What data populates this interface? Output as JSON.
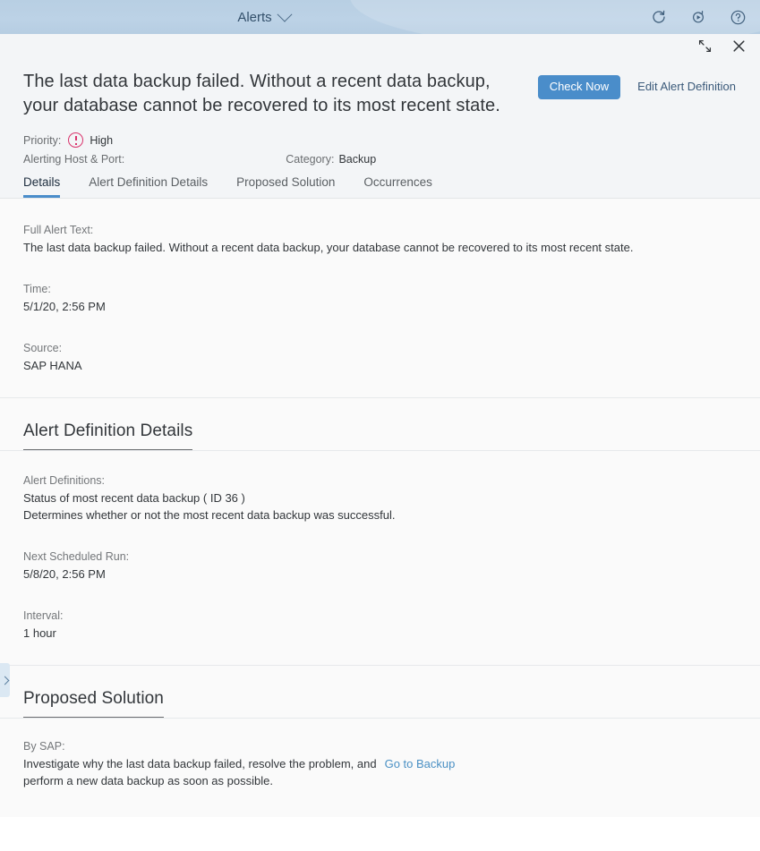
{
  "shell": {
    "title": "Alerts",
    "dropdown_icon": "chevron-down-icon",
    "actions": [
      {
        "name": "refresh-icon",
        "label": "Refresh"
      },
      {
        "name": "auto-refresh-icon",
        "label": "Auto Refresh"
      },
      {
        "name": "help-icon",
        "label": "Help"
      }
    ]
  },
  "dialog_toolbar": {
    "fullscreen_label": "Enter Full Screen",
    "close_label": "Close"
  },
  "alert": {
    "title": "The last data backup failed. Without a recent data backup, your database cannot be recovered to its most recent state.",
    "buttons": {
      "check_now": "Check Now",
      "edit_alert_definition": "Edit Alert Definition"
    },
    "priority_label": "Priority:",
    "priority_value": "High",
    "priority_icon": "alert-circle-icon",
    "host_label": "Alerting Host & Port:",
    "host_value": "",
    "category_label": "Category:",
    "category_value": "Backup"
  },
  "tabs": [
    {
      "label": "Details",
      "selected": true
    },
    {
      "label": "Alert Definition Details",
      "selected": false
    },
    {
      "label": "Proposed Solution",
      "selected": false
    },
    {
      "label": "Occurrences",
      "selected": false
    }
  ],
  "details": {
    "full_alert_text_label": "Full Alert Text:",
    "full_alert_text_value": "The last data backup failed. Without a recent data backup, your database cannot be recovered to its most recent state.",
    "time_label": "Time:",
    "time_value": "5/1/20, 2:56 PM",
    "source_label": "Source:",
    "source_value": "SAP HANA"
  },
  "alert_definition_details": {
    "heading": "Alert Definition Details",
    "definitions_label": "Alert Definitions:",
    "definitions_value_line1": "Status of most recent data backup ( ID 36 )",
    "definitions_value_line2": "Determines whether or not the most recent data backup was successful.",
    "next_run_label": "Next Scheduled Run:",
    "next_run_value": "5/8/20, 2:56 PM",
    "interval_label": "Interval:",
    "interval_value": "1 hour"
  },
  "proposed_solution": {
    "heading": "Proposed Solution",
    "by_label": "By SAP:",
    "text_line1": "Investigate why the last data backup failed, resolve the problem, and",
    "link_label": "Go to Backup",
    "text_line2": "perform a new data backup as soon as possible."
  },
  "side_panel": {
    "expand_icon": "chevron-right-icon",
    "expand_label": "Expand Side Panel"
  },
  "colors": {
    "shell_bar": "#b9d0e4",
    "accent_blue": "#4a8dca",
    "link_blue": "#4a90c4",
    "priority_high": "#d9336c",
    "body_background": "#fafafa",
    "header_background": "#f3f5f7"
  }
}
